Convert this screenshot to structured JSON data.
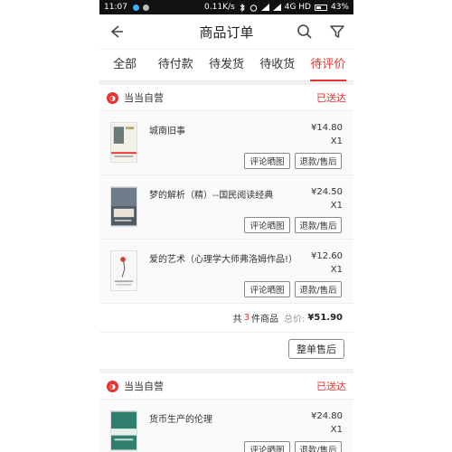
{
  "status_bar": {
    "time": "11:07",
    "speed": "0.11K/s",
    "network": "4G HD",
    "battery": "43%"
  },
  "header": {
    "title": "商品订单",
    "icons": [
      "back-arrow-icon",
      "search-icon",
      "filter-icon"
    ]
  },
  "tabs": [
    {
      "label": "全部",
      "active": false
    },
    {
      "label": "待付款",
      "active": false
    },
    {
      "label": "待发货",
      "active": false
    },
    {
      "label": "待收货",
      "active": false
    },
    {
      "label": "待评价",
      "active": true
    }
  ],
  "orders": [
    {
      "shop": "当当自营",
      "status": "已送达",
      "items": [
        {
          "name": "城南旧事",
          "price": "¥14.80",
          "qty": "X1",
          "review_label": "评论晒图",
          "refund_label": "退款/售后"
        },
        {
          "name": "梦的解析（精）--国民阅读经典",
          "price": "¥24.50",
          "qty": "X1",
          "review_label": "评论晒图",
          "refund_label": "退款/售后"
        },
        {
          "name": "爱的艺术（心理学大师弗洛姆作品!）",
          "price": "¥12.60",
          "qty": "X1",
          "review_label": "评论晒图",
          "refund_label": "退款/售后"
        }
      ],
      "summary": {
        "prefix": "共",
        "count": "3",
        "suffix": "件商品",
        "total_label": "总价:",
        "total": "¥51.90"
      },
      "aftersale_label": "整单售后"
    },
    {
      "shop": "当当自营",
      "status": "已送达",
      "items": [
        {
          "name": "货币生产的伦理",
          "price": "¥24.80",
          "qty": "X1",
          "review_label": "评论晒图",
          "refund_label": "退款/售后"
        }
      ]
    }
  ],
  "colors": {
    "accent": "#e8332f",
    "background": "#f2f2f2"
  }
}
